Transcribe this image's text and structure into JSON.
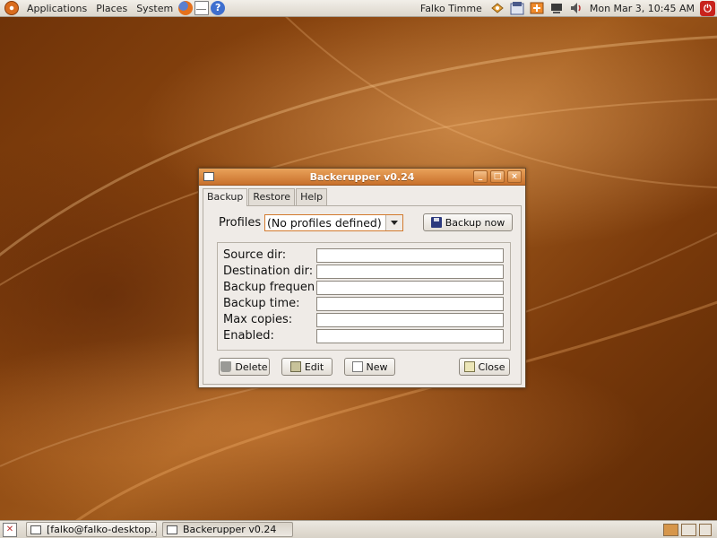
{
  "top_panel": {
    "menus": [
      "Applications",
      "Places",
      "System"
    ],
    "user": "Falko Timme",
    "clock": "Mon Mar  3, 10:45 AM",
    "help_glyph": "?"
  },
  "window": {
    "title": "Backerupper v0.24",
    "controls": {
      "minimize": "_",
      "maximize": "□",
      "close": "×"
    },
    "tabs": [
      "Backup",
      "Restore",
      "Help"
    ],
    "profiles_label": "Profiles",
    "profiles_value": "(No profiles defined)",
    "backup_now": "Backup now",
    "fields": [
      {
        "label": "Source dir:",
        "value": ""
      },
      {
        "label": "Destination dir:",
        "value": ""
      },
      {
        "label": "Backup frequency:",
        "value": ""
      },
      {
        "label": "Backup time:",
        "value": ""
      },
      {
        "label": "Max copies:",
        "value": ""
      },
      {
        "label": "Enabled:",
        "value": ""
      }
    ],
    "buttons": {
      "delete": "Delete",
      "edit": "Edit",
      "new": "New",
      "close": "Close"
    }
  },
  "taskbar": {
    "tasks": [
      "[falko@falko-desktop...",
      "Backerupper v0.24"
    ]
  },
  "icons": {
    "logo": "ubuntu-logo-icon",
    "launchers": [
      "firefox-icon",
      "mail-icon",
      "help-icon"
    ],
    "tray": [
      "network-icon",
      "update-manager-icon",
      "display-icon",
      "volume-icon",
      "quit-icon"
    ]
  },
  "colors": {
    "accent": "#d6964b",
    "titlebar": "#c8702b",
    "desktop": "#8a450f"
  }
}
